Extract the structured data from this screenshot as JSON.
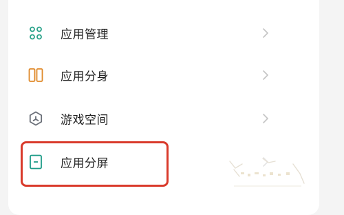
{
  "settings": {
    "items": [
      {
        "label": "应用管理",
        "icon": "app-management-icon",
        "icon_color": "#2aa38a"
      },
      {
        "label": "应用分身",
        "icon": "app-clone-icon",
        "icon_color": "#e08a2a"
      },
      {
        "label": "游戏空间",
        "icon": "game-space-icon",
        "icon_color": "#6a6f78"
      },
      {
        "label": "应用分屏",
        "icon": "split-screen-icon",
        "icon_color": "#1e9c88"
      }
    ],
    "highlighted_item": "应用分屏",
    "highlight_color": "#d93a2b"
  }
}
